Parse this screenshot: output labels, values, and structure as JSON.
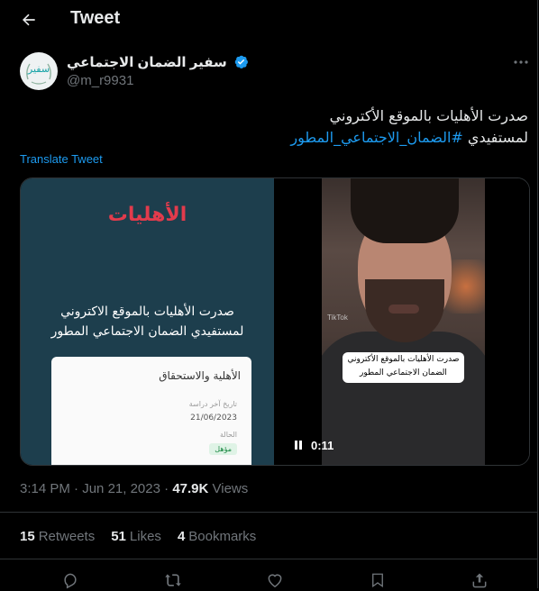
{
  "header": {
    "title": "Tweet"
  },
  "author": {
    "display_name": "سفير الضمان الاجتماعي",
    "handle": "@m_r9931",
    "avatar_text": "سفير",
    "verified": true
  },
  "tweet": {
    "line1": "صدرت الأهليات بالموقع الأكتروني",
    "line2_prefix": "لمستفيدي ",
    "hashtag": "#الضمان_الاجتماعي_المطور",
    "translate_label": "Translate Tweet"
  },
  "media": {
    "left_image": {
      "heading": "الأهليات",
      "line1": "صدرت الأهليات بالموقع الاكتروني",
      "line2": "لمستفيدي الضمان الاجتماعي المطور",
      "card_title": "الأهلية والاستحقاق",
      "card_label1": "تاريخ آخر دراسة",
      "card_date": "21/06/2023",
      "card_label2": "الحالة",
      "card_status": "مؤهل"
    },
    "video": {
      "caption_line1": "صدرت الأهليات بالموقع الأكتروني",
      "caption_line2": "الضمان الاجتماعي المطور",
      "watermark": "TikTok",
      "time": "0:11"
    }
  },
  "meta": {
    "time": "3:14 PM",
    "date": "Jun 21, 2023",
    "views_count": "47.9K",
    "views_label": "Views"
  },
  "stats": {
    "retweets_count": "15",
    "retweets_label": "Retweets",
    "likes_count": "51",
    "likes_label": "Likes",
    "bookmarks_count": "4",
    "bookmarks_label": "Bookmarks"
  },
  "colors": {
    "accent": "#1d9bf0",
    "text": "#e7e9ea",
    "muted": "#71767b",
    "border": "#2f3336",
    "background": "#000000"
  },
  "icons": [
    "back-arrow-icon",
    "verified-badge-icon",
    "more-options-icon",
    "pause-icon",
    "reply-icon",
    "retweet-icon",
    "like-icon",
    "bookmark-icon",
    "share-icon"
  ]
}
